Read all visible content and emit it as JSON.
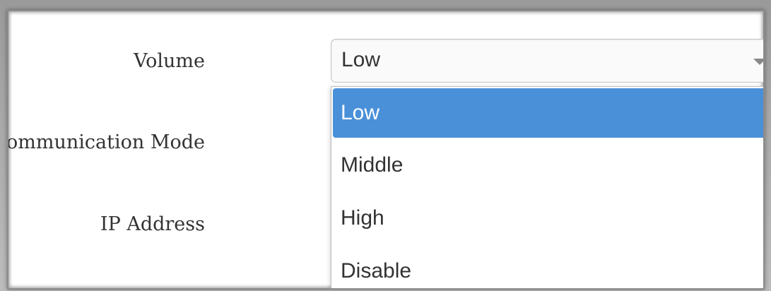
{
  "form": {
    "volume_label": "Volume",
    "communication_mode_label": "Communication Mode",
    "ip_address_label": "IP Address"
  },
  "volume_select": {
    "value": "Low",
    "options": [
      "Low",
      "Middle",
      "High",
      "Disable"
    ],
    "selected_index": 0
  },
  "colors": {
    "selected_option_bg": "#4a90d9",
    "selected_option_text": "#ffffff",
    "label_text": "#333333"
  },
  "icons": {
    "select_arrow": "chevron-down-icon"
  }
}
